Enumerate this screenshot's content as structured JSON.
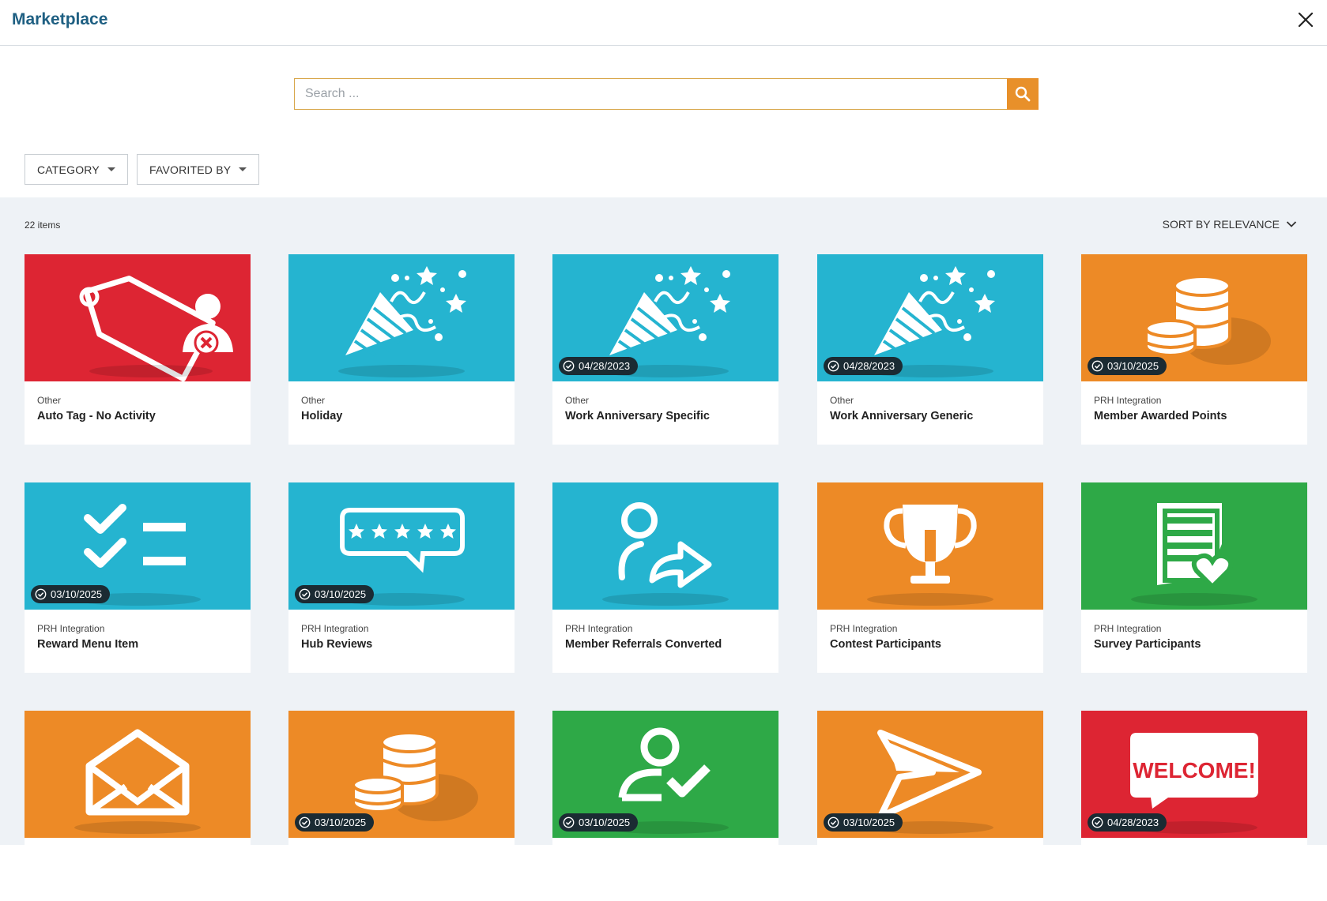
{
  "header": {
    "title": "Marketplace"
  },
  "search": {
    "placeholder": "Search ..."
  },
  "filters": {
    "category_label": "CATEGORY",
    "favorited_label": "FAVORITED BY"
  },
  "results": {
    "count_label": "22 items",
    "sort_label": "SORT BY RELEVANCE"
  },
  "colors": {
    "red": "#dd2533",
    "teal": "#25b4d0",
    "orange": "#ed8a26",
    "green": "#2ea947",
    "brand": "#1e5f82"
  },
  "cards": [
    {
      "category": "Other",
      "name": "Auto Tag - No Activity",
      "date": "",
      "color": "red",
      "icon": "tag-user-remove-icon"
    },
    {
      "category": "Other",
      "name": "Holiday",
      "date": "",
      "color": "teal",
      "icon": "party-popper-icon"
    },
    {
      "category": "Other",
      "name": "Work Anniversary Specific",
      "date": "04/28/2023",
      "color": "teal",
      "icon": "party-popper-icon"
    },
    {
      "category": "Other",
      "name": "Work Anniversary Generic",
      "date": "04/28/2023",
      "color": "teal",
      "icon": "party-popper-icon"
    },
    {
      "category": "PRH Integration",
      "name": "Member Awarded Points",
      "date": "03/10/2025",
      "color": "orange",
      "icon": "coins-icon"
    },
    {
      "category": "PRH Integration",
      "name": "Reward Menu Item",
      "date": "03/10/2025",
      "color": "teal",
      "icon": "checklist-icon"
    },
    {
      "category": "PRH Integration",
      "name": "Hub Reviews",
      "date": "03/10/2025",
      "color": "teal",
      "icon": "star-rating-icon"
    },
    {
      "category": "PRH Integration",
      "name": "Member Referrals Converted",
      "date": "",
      "color": "teal",
      "icon": "user-share-icon"
    },
    {
      "category": "PRH Integration",
      "name": "Contest Participants",
      "date": "",
      "color": "orange",
      "icon": "trophy-icon"
    },
    {
      "category": "PRH Integration",
      "name": "Survey Participants",
      "date": "",
      "color": "green",
      "icon": "survey-icon"
    },
    {
      "category": "",
      "name": "",
      "date": "",
      "color": "orange",
      "icon": "envelope-icon"
    },
    {
      "category": "",
      "name": "",
      "date": "03/10/2025",
      "color": "orange",
      "icon": "coins-icon"
    },
    {
      "category": "",
      "name": "",
      "date": "03/10/2025",
      "color": "green",
      "icon": "user-check-icon"
    },
    {
      "category": "",
      "name": "",
      "date": "03/10/2025",
      "color": "orange",
      "icon": "send-icon"
    },
    {
      "category": "",
      "name": "",
      "date": "04/28/2023",
      "color": "red",
      "icon": "welcome-sign-icon",
      "icon_text": "WELCOME!"
    }
  ]
}
